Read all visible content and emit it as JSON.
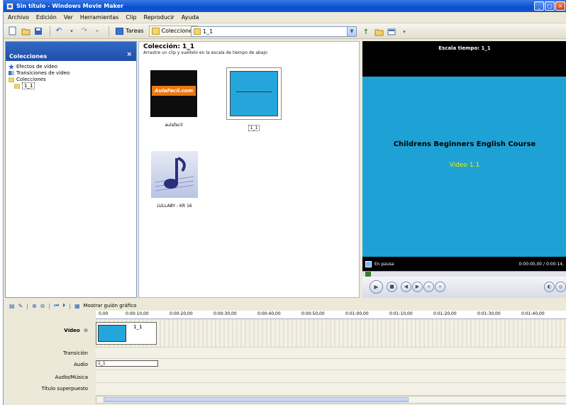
{
  "window": {
    "title": "Sin título - Windows Movie Maker",
    "btn_min": "_",
    "btn_max": "□",
    "btn_close": "×"
  },
  "menu": [
    "Archivo",
    "Edición",
    "Ver",
    "Herramientas",
    "Clip",
    "Reproducir",
    "Ayuda"
  ],
  "toolbar": {
    "tasks_label": "Tareas",
    "collections_label": "Colecciones",
    "collection_combo_value": "1_1"
  },
  "left_panel": {
    "header": "Colecciones",
    "close": "×",
    "items": [
      "Efectos de vídeo",
      "Transiciones de vídeo",
      "Colecciones",
      "1_1"
    ]
  },
  "collection": {
    "title": "Colección: 1_1",
    "hint": "Arrastre un clip y suéltelo en la escala de tiempo de abajo",
    "clips": [
      {
        "name": "aulafacil",
        "thumb_text": "AulaFacil.com"
      },
      {
        "name": "1_1"
      },
      {
        "name": "LULLABY - KR 16"
      }
    ]
  },
  "preview": {
    "title": "Escala tiempo: 1_1",
    "main_text": "Childrens Beginners English Course",
    "sub_text": "Video 1.1",
    "status": "En pausa",
    "time": "0:00:00,00 / 0:00:14,"
  },
  "timeline": {
    "show_storyboard": "Mostrar guión gráfico",
    "ruler": [
      "0,00",
      "0:00:10,00",
      "0:00:20,00",
      "0:00:30,00",
      "0:00:40,00",
      "0:00:50,00",
      "0:01:00,00",
      "0:01:10,00",
      "0:01:20,00",
      "0:01:30,00",
      "0:01:40,00"
    ],
    "tracks": [
      "Vídeo",
      "Transición",
      "Audio",
      "Audio/Música",
      "Título superpuesto"
    ],
    "video_clip_label": "1_1",
    "audio_clip_label": "1_1"
  },
  "colors": {
    "preview_bg": "#1ea2d6",
    "preview_sub": "#f0f000",
    "titlebar": "#0a50d0"
  }
}
